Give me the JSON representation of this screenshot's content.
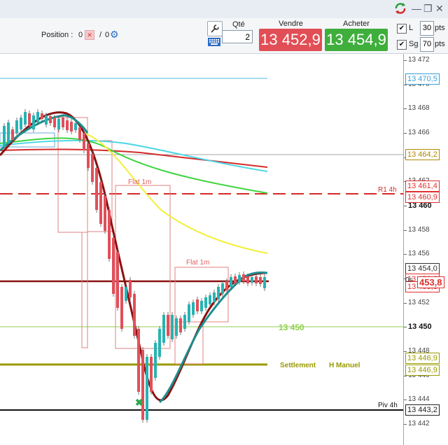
{
  "window": {
    "app_icon": "refresh-arrows-icon",
    "controls": [
      "minimize-icon",
      "restore-icon",
      "close-icon"
    ]
  },
  "position": {
    "label": "Position :",
    "value": "0",
    "value2": "0"
  },
  "order": {
    "qty_label": "Qté",
    "qty_value": "2",
    "sell_label": "Vendre",
    "buy_label": "Acheter",
    "sell_price": "13 452,9",
    "buy_price": "13 454,9"
  },
  "stops": {
    "l_label": "L",
    "l_value": "30",
    "sg_label": "Sg",
    "sg_value": "70",
    "pts_label": "pts"
  },
  "axis": {
    "ticks": [
      "13 472",
      "13 470",
      "13 468",
      "13 466",
      "13 464",
      "13 462",
      "13 460",
      "13 458",
      "13 456",
      "13 454",
      "13 452",
      "13 450",
      "13 448",
      "13 446",
      "13 444",
      "13 442"
    ],
    "tags": [
      {
        "text": "13 470,5",
        "color": "#3aa0d8"
      },
      {
        "text": "13 464,2",
        "color": "#b08800"
      },
      {
        "text": "13 461,4",
        "color": "#e03030"
      },
      {
        "text": "13 460,9",
        "color": "#e03030"
      },
      {
        "text": "13 454,0",
        "color": "#333333"
      },
      {
        "text": "13 453,8",
        "color": "#e03030"
      },
      {
        "text": "13 453,8",
        "color": "#e03030"
      },
      {
        "text": "13 446,9",
        "color": "#9a9a00"
      },
      {
        "text": "13 446,9",
        "color": "#9a9a00"
      },
      {
        "text": "13 443,2",
        "color": "#222222"
      }
    ],
    "bold_ticks": [
      "13 460",
      "13 450"
    ],
    "current_tag": "453,8",
    "timer_tag": "0s"
  },
  "chart_labels": {
    "flat1": "Flat 1m",
    "flat2": "Flat 1m",
    "r1": "R1 4h",
    "piv": "Piv 4h",
    "level_450": "13 450",
    "settlement": "Settlement",
    "hmanuel": "H Manuel"
  },
  "colors": {
    "sell": "#e24e56",
    "buy": "#3fae3c",
    "bull": "#27b3b3",
    "bear": "#e0505a"
  }
}
